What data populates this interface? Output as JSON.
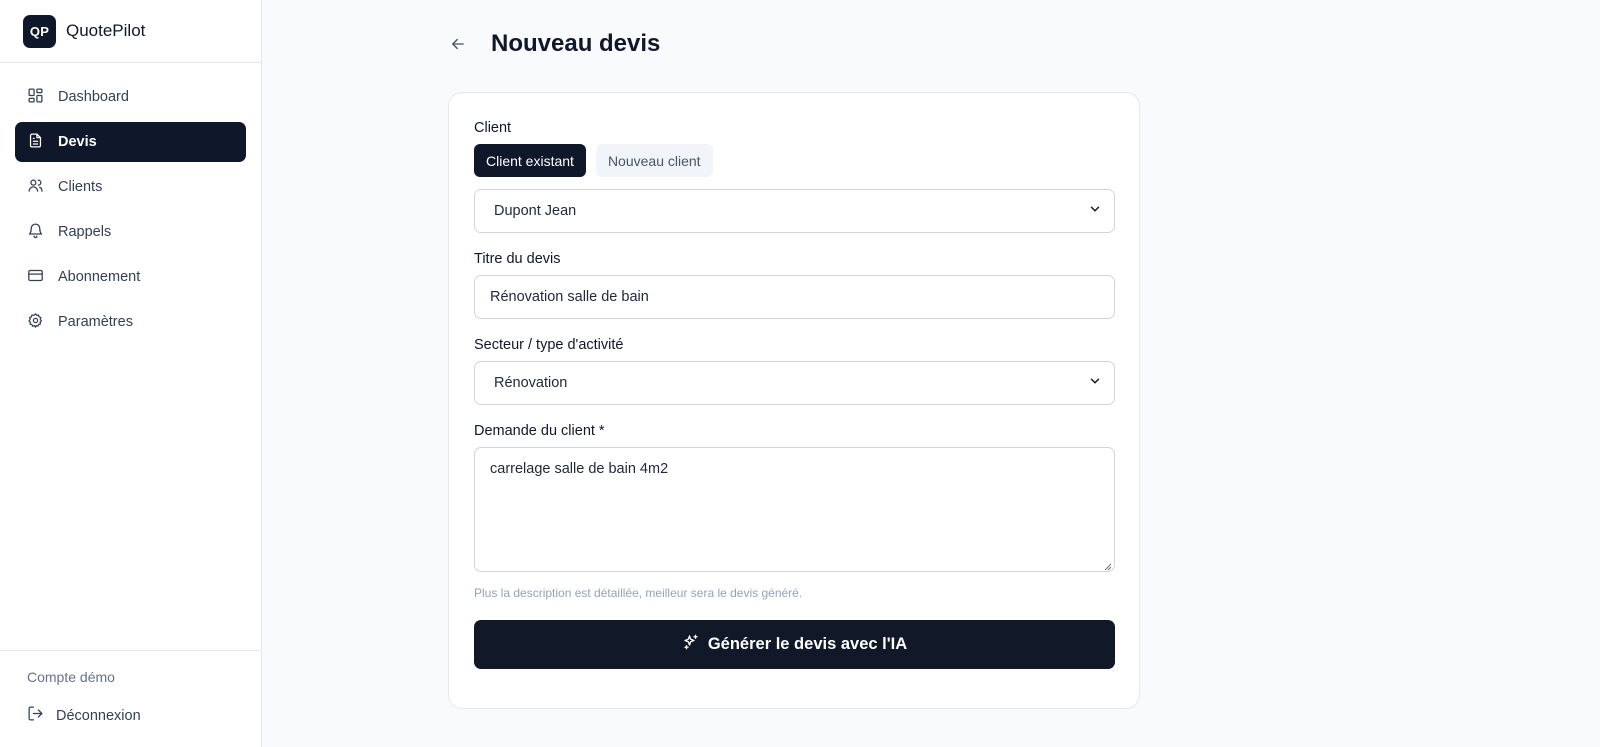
{
  "brand": {
    "logo_text": "QP",
    "name": "QuotePilot"
  },
  "sidebar": {
    "items": [
      {
        "label": "Dashboard",
        "icon": "dashboard-icon",
        "active": false
      },
      {
        "label": "Devis",
        "icon": "document-icon",
        "active": true
      },
      {
        "label": "Clients",
        "icon": "users-icon",
        "active": false
      },
      {
        "label": "Rappels",
        "icon": "bell-icon",
        "active": false
      },
      {
        "label": "Abonnement",
        "icon": "credit-card-icon",
        "active": false
      },
      {
        "label": "Paramètres",
        "icon": "gear-icon",
        "active": false
      }
    ],
    "account_name": "Compte démo",
    "logout_label": "Déconnexion"
  },
  "page": {
    "title": "Nouveau devis"
  },
  "form": {
    "client_label": "Client",
    "client_toggle": {
      "existing": "Client existant",
      "new": "Nouveau client",
      "selected": "existing"
    },
    "client_select_value": "Dupont Jean",
    "title_label": "Titre du devis",
    "title_value": "Rénovation salle de bain",
    "sector_label": "Secteur / type d'activité",
    "sector_value": "Rénovation",
    "request_label": "Demande du client *",
    "request_value": "carrelage salle de bain 4m2",
    "request_hint": "Plus la description est détaillée, meilleur sera le devis généré.",
    "submit_label": "Générer le devis avec l'IA"
  },
  "colors": {
    "primary": "#0f172a",
    "border": "#d1d5db",
    "background": "#f8fafc"
  }
}
